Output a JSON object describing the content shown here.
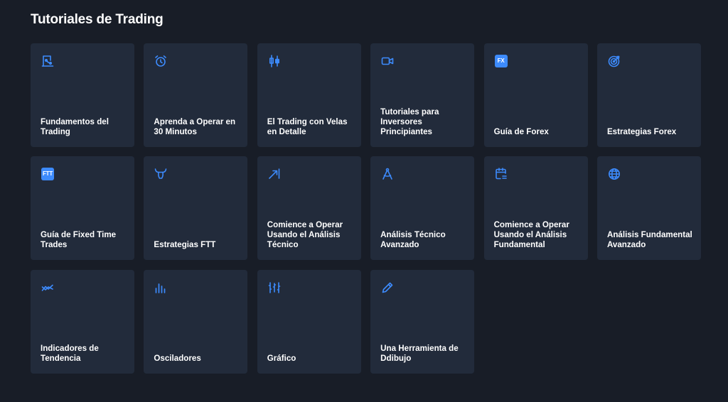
{
  "page": {
    "title": "Tutoriales de Trading"
  },
  "colors": {
    "background": "#181d27",
    "card": "#222b3b",
    "accent": "#3d8bfd",
    "text": "#ffffff"
  },
  "cards": [
    {
      "label": "Fundamentos del Trading",
      "icon": "chart-board-icon"
    },
    {
      "label": "Aprenda a Operar en 30 Minutos",
      "icon": "alarm-clock-icon"
    },
    {
      "label": "El Trading con Velas en Detalle",
      "icon": "candlestick-icon"
    },
    {
      "label": "Tutoriales para Inversores Principiantes",
      "icon": "video-camera-icon"
    },
    {
      "label": "Guía de Forex",
      "icon": "fx-badge-icon",
      "badge": "FX"
    },
    {
      "label": "Estrategias Forex",
      "icon": "target-icon"
    },
    {
      "label": "Guía de Fixed Time Trades",
      "icon": "ftt-badge-icon",
      "badge": "FTT"
    },
    {
      "label": "Estrategias FTT",
      "icon": "bull-icon"
    },
    {
      "label": "Comience a Operar Usando el Análisis Técnico",
      "icon": "trend-arrow-icon"
    },
    {
      "label": "Análisis Técnico Avanzado",
      "icon": "compass-icon"
    },
    {
      "label": "Comience a Operar Usando el Análisis Fundamental",
      "icon": "calendar-icon"
    },
    {
      "label": "Análisis Fundamental Avanzado",
      "icon": "globe-icon"
    },
    {
      "label": "Indicadores de Tendencia",
      "icon": "trend-lines-icon"
    },
    {
      "label": "Osciladores",
      "icon": "bars-icon"
    },
    {
      "label": "Gráfico",
      "icon": "chart-sticks-icon"
    },
    {
      "label": "Una Herramienta de Ddibujo",
      "icon": "pencil-icon"
    }
  ]
}
